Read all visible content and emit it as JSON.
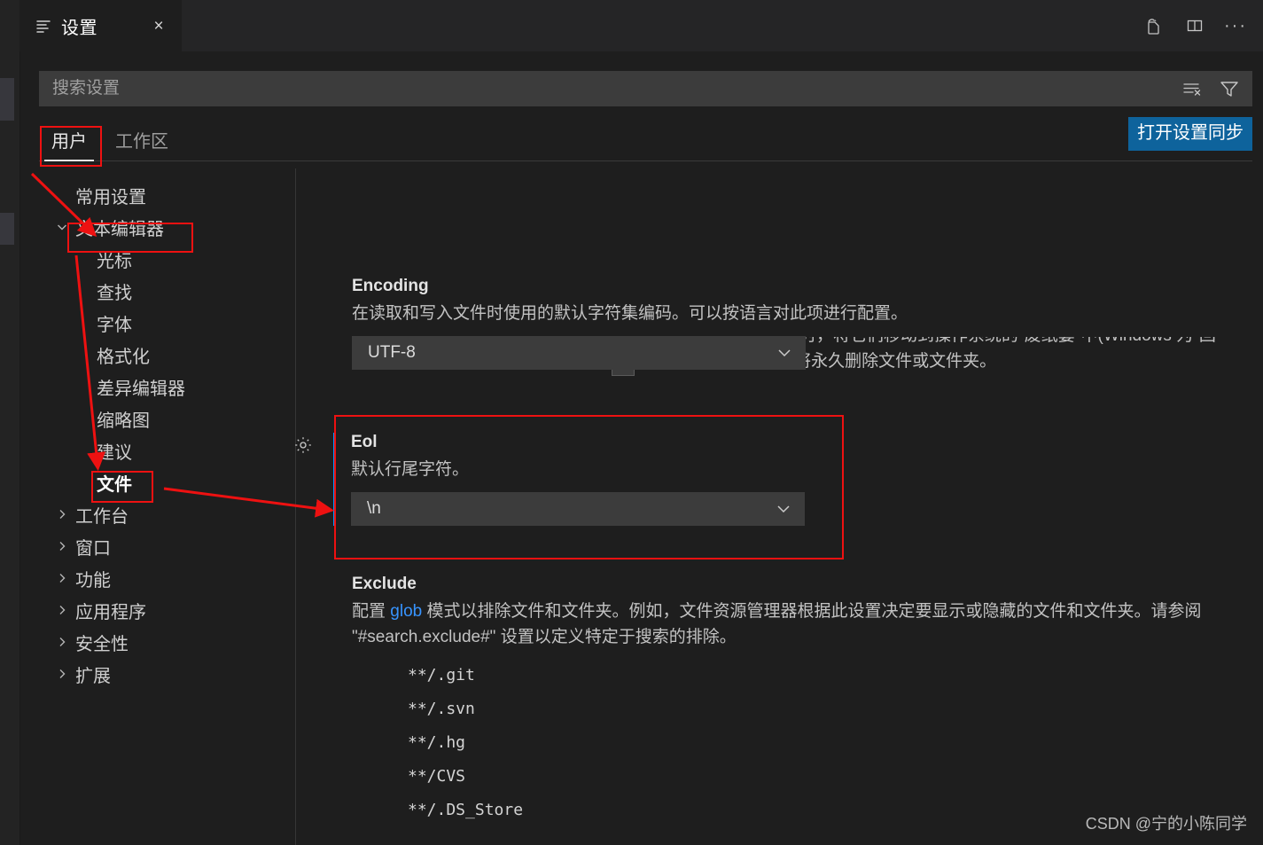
{
  "window": {
    "tab": {
      "icon": "settings-list-icon",
      "title": "设置",
      "close_icon": "×"
    },
    "tab_actions": [
      {
        "name": "open-settings-json-icon",
        "label": "打开设置(JSON)"
      },
      {
        "name": "split-editor-icon",
        "label": "拆分编辑器"
      },
      {
        "name": "more-actions-icon",
        "label": "···"
      }
    ]
  },
  "search": {
    "placeholder": "搜索设置",
    "value": "",
    "actions": [
      {
        "name": "clear-search-icon",
        "label": "清除搜索结果"
      },
      {
        "name": "filter-icon",
        "label": "筛选设置"
      }
    ]
  },
  "scope": {
    "tabs": [
      {
        "label": "用户",
        "active": true
      },
      {
        "label": "工作区",
        "active": false
      }
    ],
    "sync_button": "打开设置同步"
  },
  "toc": {
    "items": [
      {
        "label": "常用设置",
        "level": 0,
        "twisty": "none",
        "selected": false
      },
      {
        "label": "文本编辑器",
        "level": 0,
        "twisty": "expanded",
        "selected": false
      },
      {
        "label": "光标",
        "level": 1,
        "twisty": "none",
        "selected": false
      },
      {
        "label": "查找",
        "level": 1,
        "twisty": "none",
        "selected": false
      },
      {
        "label": "字体",
        "level": 1,
        "twisty": "none",
        "selected": false
      },
      {
        "label": "格式化",
        "level": 1,
        "twisty": "none",
        "selected": false
      },
      {
        "label": "差异编辑器",
        "level": 1,
        "twisty": "none",
        "selected": false
      },
      {
        "label": "缩略图",
        "level": 1,
        "twisty": "none",
        "selected": false
      },
      {
        "label": "建议",
        "level": 1,
        "twisty": "none",
        "selected": false
      },
      {
        "label": "文件",
        "level": 1,
        "twisty": "none",
        "selected": true
      },
      {
        "label": "工作台",
        "level": 0,
        "twisty": "collapsed",
        "selected": false
      },
      {
        "label": "窗口",
        "level": 0,
        "twisty": "collapsed",
        "selected": false
      },
      {
        "label": "功能",
        "level": 0,
        "twisty": "collapsed",
        "selected": false
      },
      {
        "label": "应用程序",
        "level": 0,
        "twisty": "collapsed",
        "selected": false
      },
      {
        "label": "安全性",
        "level": 0,
        "twisty": "collapsed",
        "selected": false
      },
      {
        "label": "扩展",
        "level": 0,
        "twisty": "collapsed",
        "selected": false
      }
    ]
  },
  "settings": {
    "trash_setting": {
      "checkbox_checked": true,
      "description": "在删除文件或文件夹时，将它们移动到操作系统的\"废纸篓\"中(Windows 为\"回收站\")。禁用此设置将永久删除文件或文件夹。"
    },
    "encoding": {
      "title": "Encoding",
      "description": "在读取和写入文件时使用的默认字符集编码。可以按语言对此项进行配置。",
      "value": "UTF-8"
    },
    "eol": {
      "title": "Eol",
      "description": "默认行尾字符。",
      "value": "\\n",
      "modified": true,
      "gear_icon": "gear-icon"
    },
    "exclude": {
      "title": "Exclude",
      "description_part1": "配置 ",
      "description_link": "glob",
      "description_part2": " 模式以排除文件和文件夹。例如，文件资源管理器根据此设置决定要显示或隐藏的文件和文件夹。请参阅 \"#search.exclude#\" 设置以定义特定于搜索的排除。",
      "items": [
        "**/.git",
        "**/.svn",
        "**/.hg",
        "**/CVS",
        "**/.DS_Store"
      ]
    }
  },
  "annotation": {
    "color": "#ee1111",
    "boxes": [
      "用户",
      "文本编辑器",
      "文件",
      "Eol"
    ],
    "arrows": 3
  },
  "watermark": "CSDN @宁的小陈同学"
}
